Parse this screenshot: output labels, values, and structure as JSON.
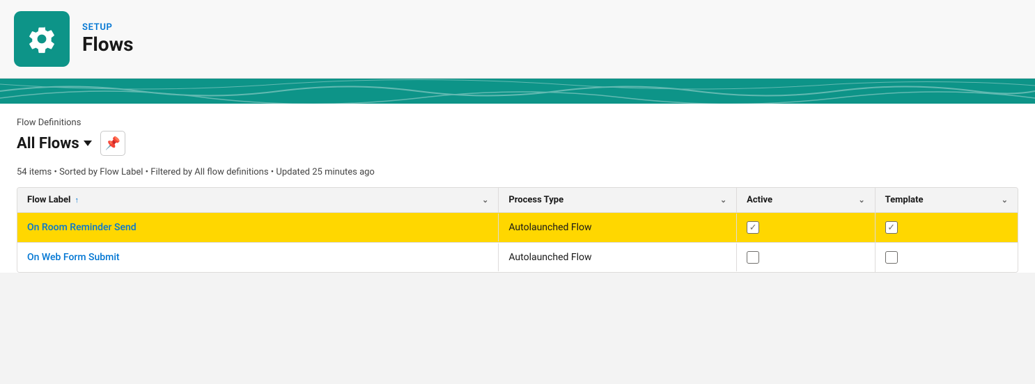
{
  "header": {
    "setup_label": "SETUP",
    "flows_label": "Flows",
    "icon_name": "gear-icon"
  },
  "breadcrumb": {
    "label": "Flow Definitions"
  },
  "title": {
    "all_flows": "All Flows",
    "pin_icon": "📌"
  },
  "status_bar": {
    "text": "54 items • Sorted by Flow Label • Filtered by All flow definitions • Updated 25 minutes ago"
  },
  "table": {
    "columns": [
      {
        "label": "Flow Label",
        "sort": "↑",
        "chevron": "⌄"
      },
      {
        "label": "Process Type",
        "chevron": "⌄"
      },
      {
        "label": "Active",
        "chevron": "⌄"
      },
      {
        "label": "Template",
        "chevron": "⌄"
      }
    ],
    "rows": [
      {
        "id": "row-1",
        "highlighted": true,
        "flow_label": "On Room Reminder Send",
        "process_type": "Autolaunched Flow",
        "active": true,
        "template": true
      },
      {
        "id": "row-2",
        "highlighted": false,
        "flow_label": "On Web Form Submit",
        "process_type": "Autolaunched Flow",
        "active": false,
        "template": false
      }
    ]
  },
  "colors": {
    "teal": "#0d9488",
    "blue_link": "#0176d3",
    "highlight_yellow": "#ffd700"
  }
}
